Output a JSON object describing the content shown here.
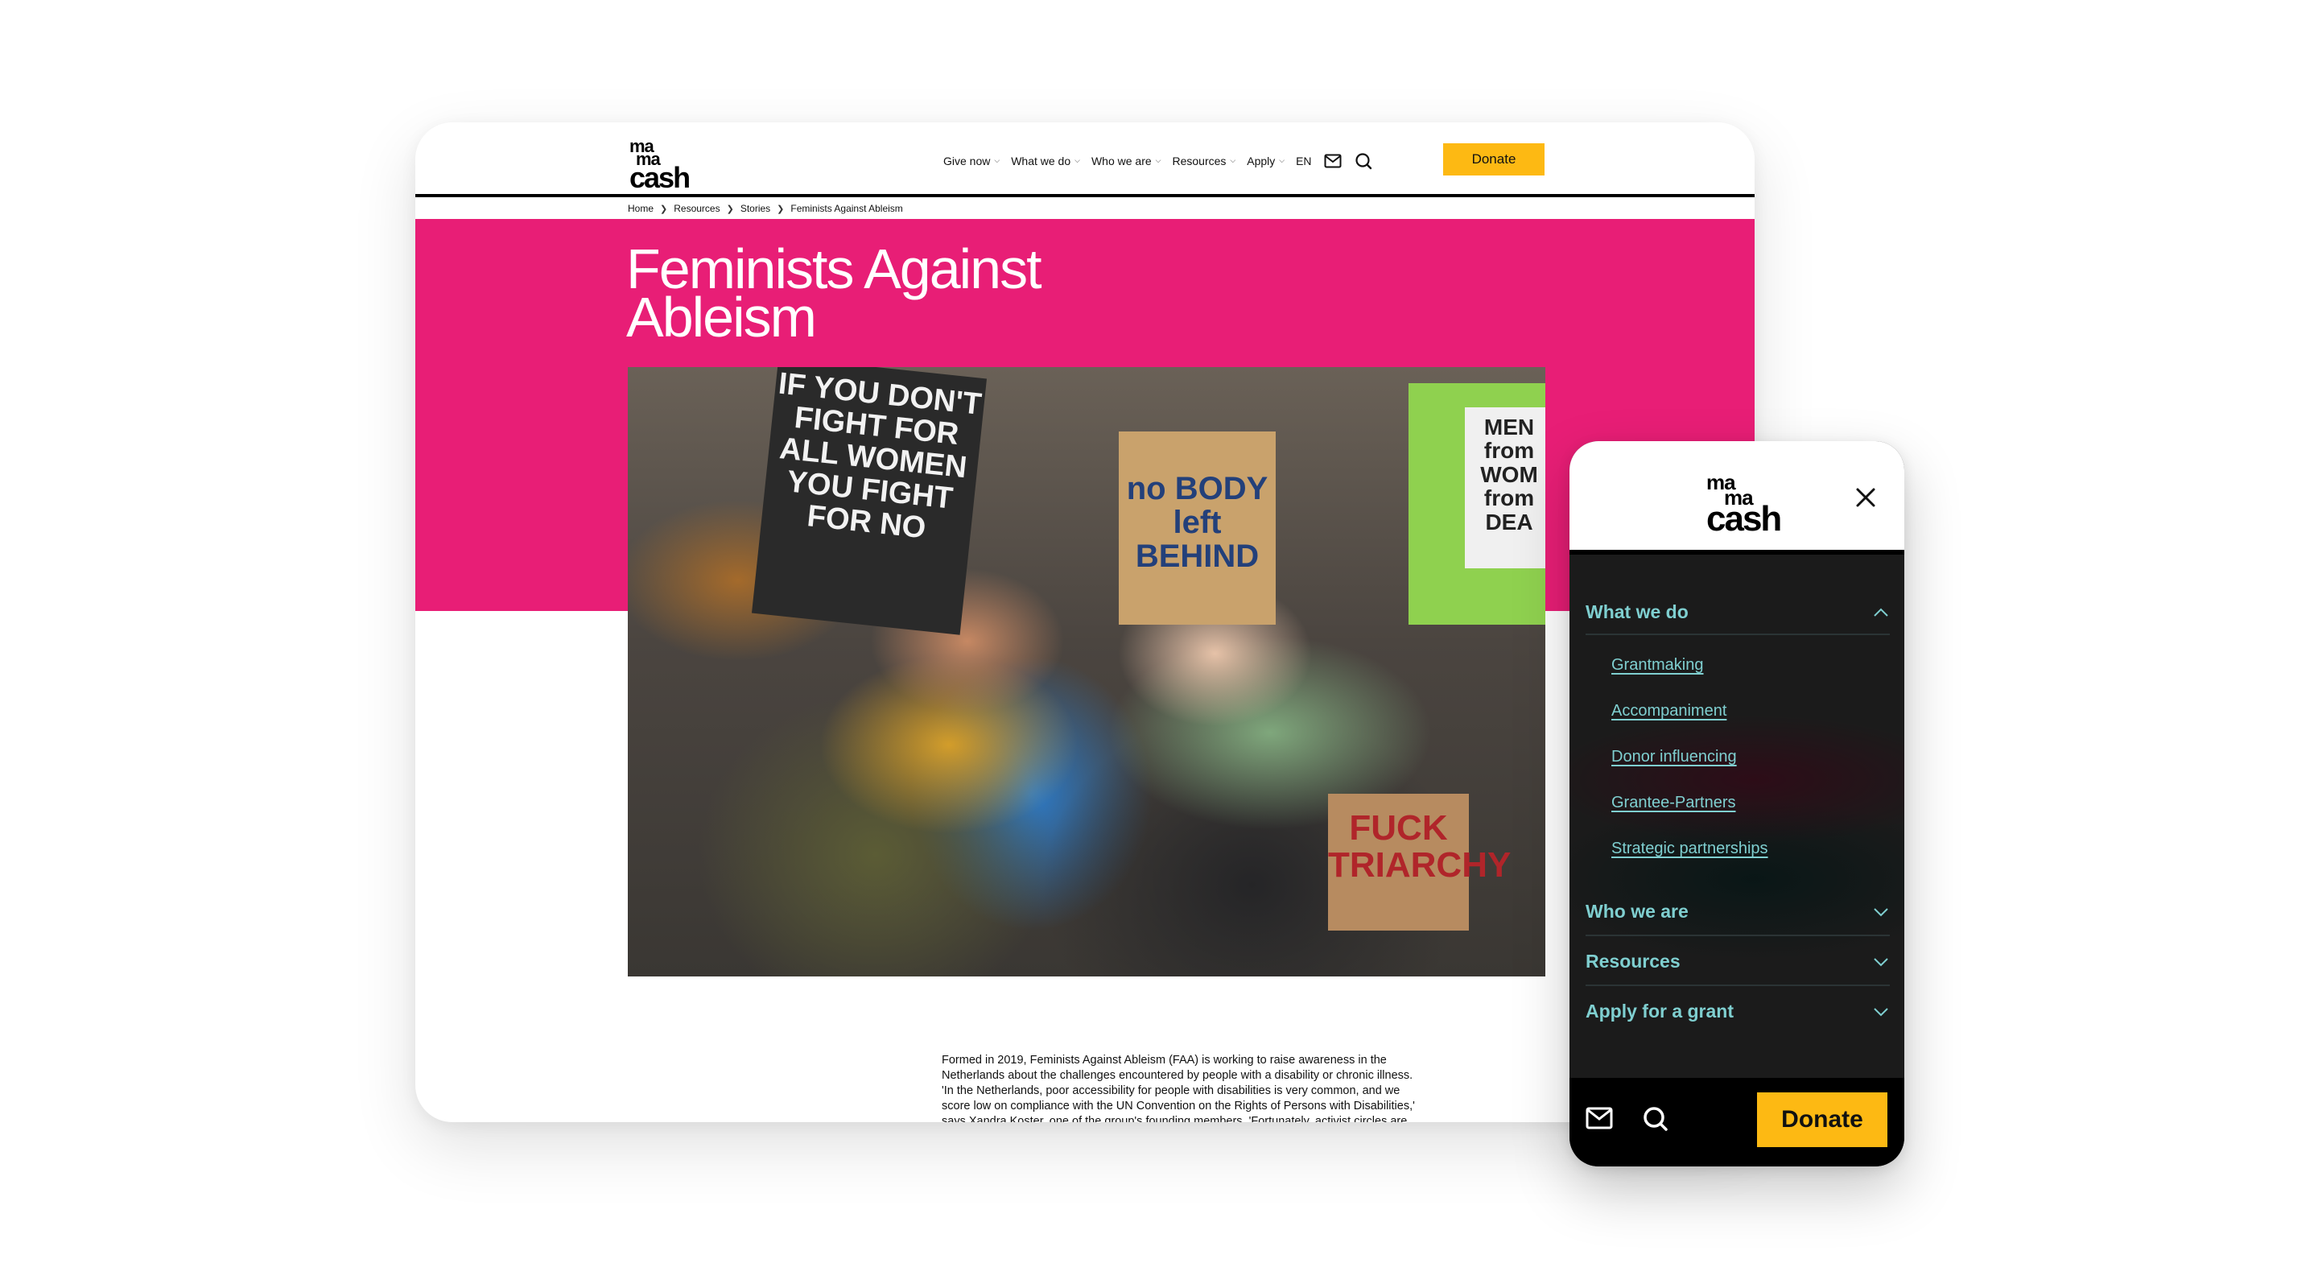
{
  "brand": {
    "logo_lines": [
      "ma",
      "ma",
      "cash"
    ],
    "accent_pink": "#e81e76",
    "donate_yellow": "#fdb913",
    "menu_teal": "#7fcfd0"
  },
  "desktop": {
    "nav": {
      "items": [
        {
          "label": "Give now",
          "has_dropdown": true
        },
        {
          "label": "What we do",
          "has_dropdown": true
        },
        {
          "label": "Who we are",
          "has_dropdown": true
        },
        {
          "label": "Resources",
          "has_dropdown": true
        },
        {
          "label": "Apply",
          "has_dropdown": true
        }
      ],
      "language": "EN",
      "icons": [
        "mail-icon",
        "search-icon"
      ],
      "donate_label": "Donate"
    },
    "breadcrumb": [
      "Home",
      "Resources",
      "Stories",
      "Feminists Against Ableism"
    ],
    "title": "Feminists Against Ableism",
    "photo": {
      "signs": {
        "sign1": "IF YOU DON'T FIGHT FOR ALL WOMEN YOU FIGHT FOR NO",
        "sign2": "no BODY left BEHIND",
        "sign3": "MEN from WOM from DEA",
        "sign4": "FUCK TRIARCHY"
      }
    },
    "body_text": "Formed in 2019, Feminists Against Ableism (FAA) is working to raise awareness in the Netherlands about the challenges encountered by people with a disability or chronic illness. 'In the Netherlands, poor accessibility for people with disabilities is very common, and we score low on compliance with the UN Convention on the Rights of Persons with Disabilities,' says Xandra Koster, one of the group's founding members. 'Fortunately, activist circles are increasingly aware that attention should be paid to the disability"
  },
  "mobile": {
    "menu": [
      {
        "label": "What we do",
        "expanded": true,
        "children": [
          "Grantmaking",
          "Accompaniment",
          "Donor influencing",
          "Grantee-Partners",
          "Strategic partnerships"
        ]
      },
      {
        "label": "Who we are",
        "expanded": false
      },
      {
        "label": "Resources",
        "expanded": false
      },
      {
        "label": "Apply for a grant",
        "expanded": false
      }
    ],
    "footer": {
      "icons": [
        "mail-icon",
        "search-icon"
      ],
      "donate_label": "Donate"
    }
  }
}
